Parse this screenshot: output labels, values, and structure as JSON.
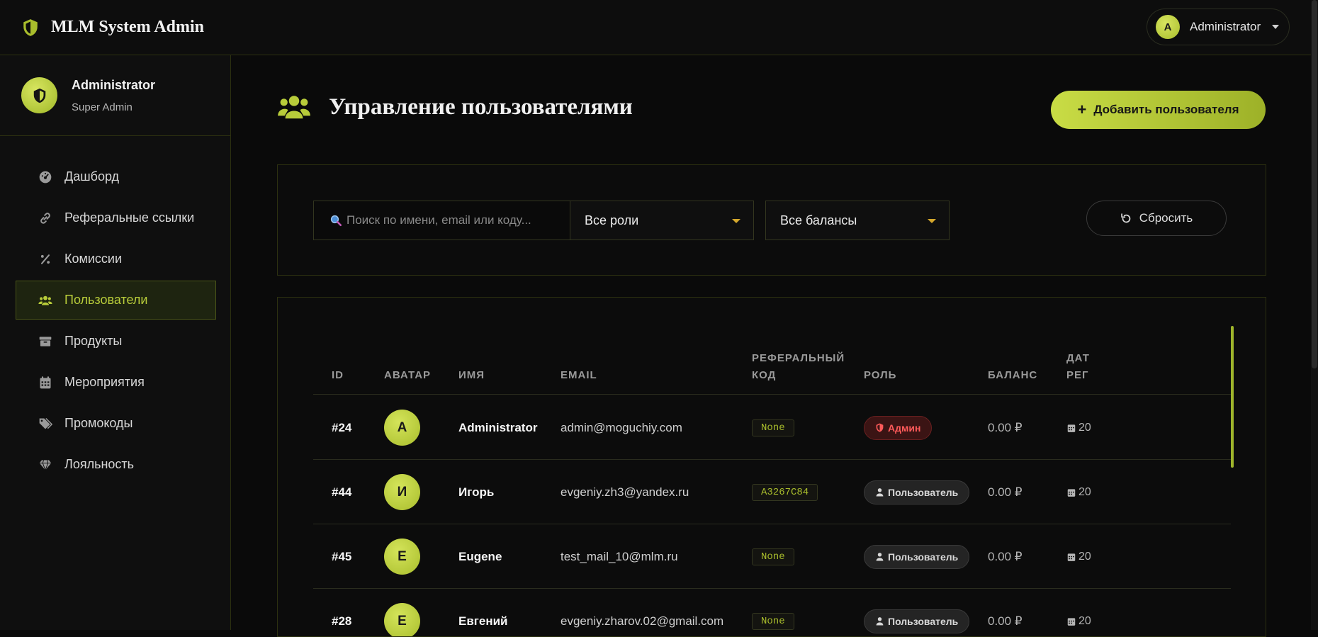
{
  "topbar": {
    "title": "MLM System Admin",
    "user_initial": "A",
    "user_name": "Administrator"
  },
  "sidebar": {
    "profile_name": "Administrator",
    "profile_role": "Super Admin",
    "items": [
      {
        "label": "Дашборд",
        "icon": "dashboard-icon",
        "active": false
      },
      {
        "label": "Реферальные ссылки",
        "icon": "link-icon",
        "active": false
      },
      {
        "label": "Комиссии",
        "icon": "percent-icon",
        "active": false
      },
      {
        "label": "Пользователи",
        "icon": "users-icon",
        "active": true
      },
      {
        "label": "Продукты",
        "icon": "box-icon",
        "active": false
      },
      {
        "label": "Мероприятия",
        "icon": "calendar-icon",
        "active": false
      },
      {
        "label": "Промокоды",
        "icon": "tags-icon",
        "active": false
      },
      {
        "label": "Лояльность",
        "icon": "gem-icon",
        "active": false
      }
    ]
  },
  "main": {
    "title": "Управление пользователями",
    "add_button": "Добавить пользователя"
  },
  "filters": {
    "search_placeholder": "Поиск по имени, email или коду...",
    "role_select": "Все роли",
    "balance_select": "Все балансы",
    "reset_button": "Сбросить"
  },
  "table": {
    "headers": {
      "id": "ID",
      "avatar": "АВАТАР",
      "name": "ИМЯ",
      "email": "EMAIL",
      "ref_code_1": "РЕФЕРАЛЬНЫЙ",
      "ref_code_2": "КОД",
      "role": "РОЛЬ",
      "balance": "БАЛАНС",
      "date_1": "ДАТ",
      "date_2": "РЕГ"
    },
    "rows": [
      {
        "id": "#24",
        "initial": "A",
        "name": "Administrator",
        "email": "admin@moguchiy.com",
        "ref_code": "None",
        "role": "Админ",
        "role_type": "admin",
        "balance": "0.00 ₽",
        "date": "20"
      },
      {
        "id": "#44",
        "initial": "И",
        "name": "Игорь",
        "email": "evgeniy.zh3@yandex.ru",
        "ref_code": "A3267C84",
        "role": "Пользователь",
        "role_type": "user",
        "balance": "0.00 ₽",
        "date": "20"
      },
      {
        "id": "#45",
        "initial": "E",
        "name": "Eugene",
        "email": "test_mail_10@mlm.ru",
        "ref_code": "None",
        "role": "Пользователь",
        "role_type": "user",
        "balance": "0.00 ₽",
        "date": "20"
      },
      {
        "id": "#28",
        "initial": "E",
        "name": "Евгений",
        "email": "evgeniy.zharov.02@gmail.com",
        "ref_code": "None",
        "role": "Пользователь",
        "role_type": "user",
        "balance": "0.00 ₽",
        "date": "20"
      }
    ]
  },
  "colors": {
    "accent": "#b8cc3a",
    "background": "#0a0a0a",
    "admin_badge": "#ff5a5a"
  }
}
